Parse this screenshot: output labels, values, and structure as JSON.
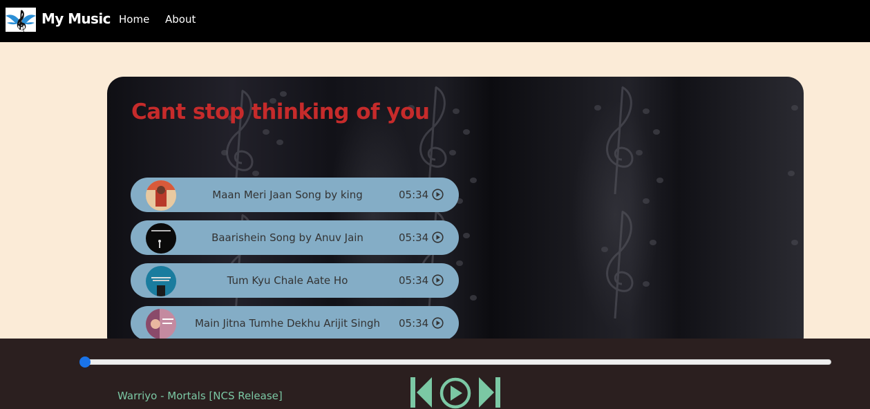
{
  "navbar": {
    "brand": "My Music",
    "links": [
      "Home",
      "About"
    ]
  },
  "main": {
    "title": "Cant stop thinking of you",
    "songs": [
      {
        "name": "Maan Meri Jaan Song by king",
        "duration": "05:34",
        "cover_color": "#d85a3a"
      },
      {
        "name": "Baarishein Song by Anuv Jain",
        "duration": "05:34",
        "cover_color": "#0a0a0a"
      },
      {
        "name": "Tum Kyu Chale Aate Ho",
        "duration": "05:34",
        "cover_color": "#1a7c9e"
      },
      {
        "name": "Main Jitna Tumhe Dekhu Arijit Singh",
        "duration": "05:34",
        "cover_color": "#c48aa0"
      }
    ]
  },
  "player": {
    "now_playing": "Warriyo - Mortals [NCS Release]",
    "progress": 0,
    "controls": [
      "previous-icon",
      "play-icon",
      "next-icon"
    ]
  },
  "colors": {
    "navbar_bg": "#000000",
    "page_bg": "#fbebd7",
    "song_item_bg": "#84adc6",
    "title_red": "#c62b2b",
    "player_bg": "#2b1f1f",
    "player_accent": "#7bc8a4",
    "progress_thumb": "#1a73e8"
  }
}
